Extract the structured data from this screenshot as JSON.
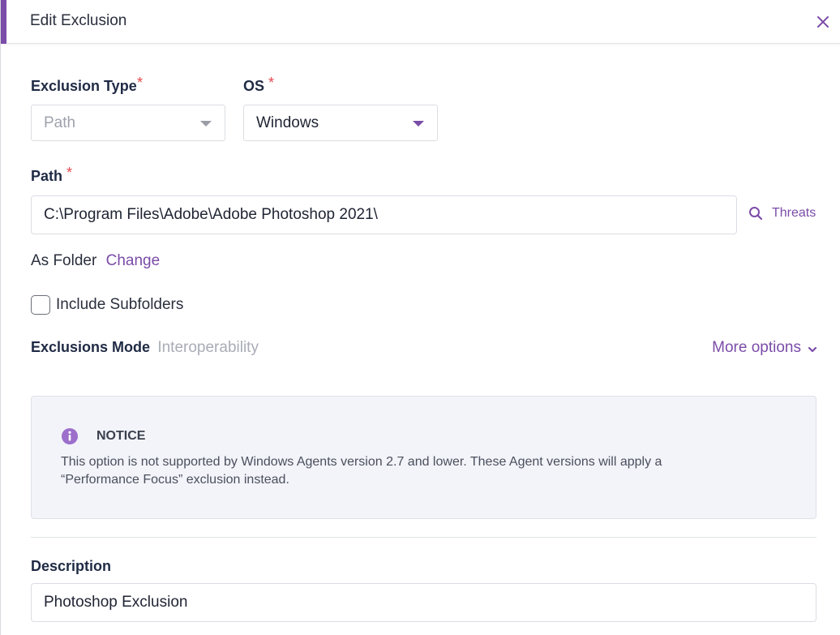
{
  "header": {
    "title": "Edit Exclusion",
    "accent_color": "#7b4ca8"
  },
  "exclusion_type": {
    "label": "Exclusion Type",
    "required_mark": "*",
    "value": "Path"
  },
  "os": {
    "label": "OS",
    "required_mark": "*",
    "value": "Windows"
  },
  "path": {
    "label": "Path",
    "required_mark": "*",
    "value": "C:\\Program Files\\Adobe\\Adobe Photoshop 2021\\",
    "threats_link": "Threats"
  },
  "as_folder": {
    "text": "As Folder",
    "change_link": "Change"
  },
  "include_subfolders": {
    "label": "Include Subfolders",
    "checked": false
  },
  "exclusions_mode": {
    "label": "Exclusions Mode",
    "value": "Interoperability",
    "more_options": "More options"
  },
  "notice": {
    "title": "NOTICE",
    "line1": "This option is not supported by Windows Agents version 2.7 and lower. These Agent versions will apply a",
    "line2": "“Performance Focus” exclusion instead."
  },
  "description": {
    "label": "Description",
    "value": "Photoshop Exclusion"
  },
  "colors": {
    "accent": "#7b4ca8",
    "required": "#e5484d",
    "muted": "#9ea2ad"
  }
}
